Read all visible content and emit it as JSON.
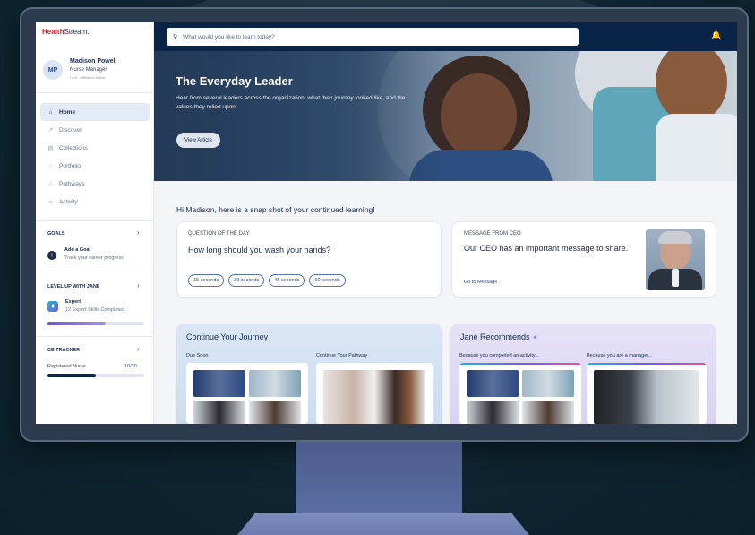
{
  "app": {
    "brand_red": "Health",
    "brand_rest": "Stream."
  },
  "profile": {
    "initials": "MP",
    "name": "Madison Powell",
    "role": "Nurse Manager",
    "org": "HCA - Affiliation Name"
  },
  "nav": [
    {
      "label": "Home",
      "icon": "home-icon",
      "glyph": "⌂",
      "active": true
    },
    {
      "label": "Discover",
      "icon": "compass-icon",
      "glyph": "↗",
      "active": false
    },
    {
      "label": "Collections",
      "icon": "collections-icon",
      "glyph": "▤",
      "active": false
    },
    {
      "label": "Portfolio",
      "icon": "portfolio-icon",
      "glyph": "○",
      "active": false
    },
    {
      "label": "Pathways",
      "icon": "pathways-icon",
      "glyph": "◇",
      "active": false
    },
    {
      "label": "Activity",
      "icon": "activity-icon",
      "glyph": "≈",
      "active": false
    }
  ],
  "goals": {
    "title": "GOALS",
    "add_label": "Add a Goal",
    "add_sub": "Track your career progress"
  },
  "level_up": {
    "title": "LEVEL UP WITH JANE",
    "badge": "Expert",
    "sub": "12 Expert Skills Completed",
    "progress": 0.6
  },
  "ce_tracker": {
    "title": "CE TRACKER",
    "label": "Registered Nurse",
    "count": "10/20",
    "progress": 0.5
  },
  "search": {
    "placeholder": "What would you like to learn today?"
  },
  "hero": {
    "title": "The Everyday Leader",
    "subtitle": "Hear from several leaders across the organization, what their journey looked like, and the values they relied upon.",
    "button": "View Article"
  },
  "greeting": "Hi Madison, here is a snap shot of your continued learning!",
  "question": {
    "header": "QUESTION OF THE DAY",
    "text": "How long should you wash your hands?",
    "options": [
      "15 seconds",
      "30 seconds",
      "45 seconds",
      "60 seconds"
    ]
  },
  "ceo_message": {
    "header": "MESSAGE FROM CEO",
    "text": "Our CEO has an important message to share.",
    "link": "Go to Message"
  },
  "journey": {
    "title": "Continue Your Journey",
    "col1": "Due Soon",
    "col2": "Continue Your Pathway"
  },
  "recommends": {
    "title": "Jane Recommends",
    "col1": "Because you completed an activity...",
    "col2": "Because you are a manager..."
  },
  "colors": {
    "navy": "#0a2447",
    "accent": "#2a4c8c",
    "brand_red": "#d3242f"
  }
}
